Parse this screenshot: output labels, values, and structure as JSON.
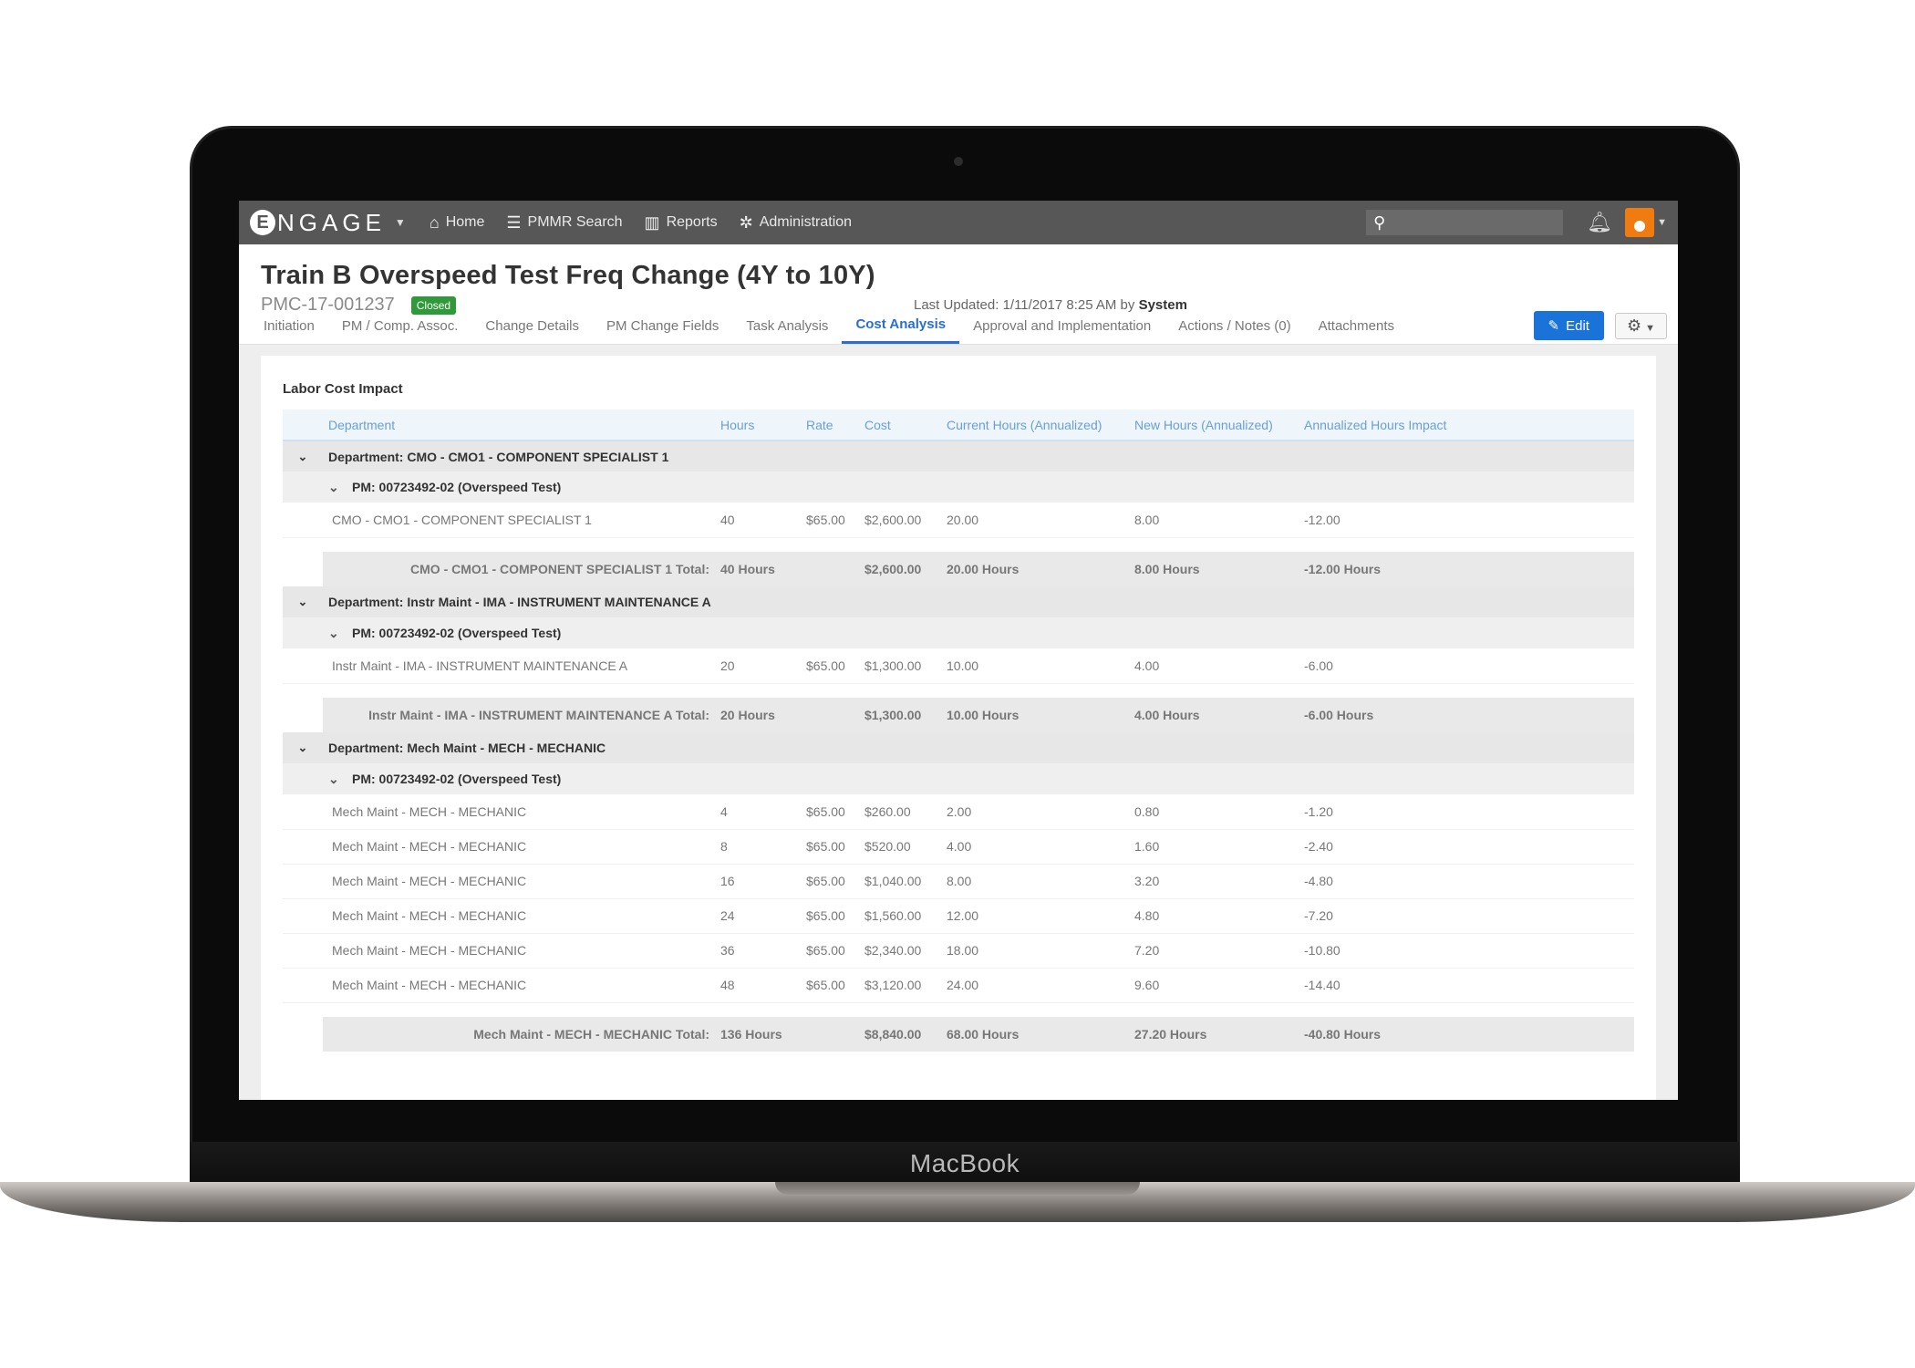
{
  "device": {
    "label": "MacBook"
  },
  "topbar": {
    "logo_letter": "E",
    "logo_text": "NGAGE",
    "nav": [
      {
        "label": "Home",
        "icon": "home-icon"
      },
      {
        "label": "PMMR Search",
        "icon": "list-icon"
      },
      {
        "label": "Reports",
        "icon": "chart-icon"
      },
      {
        "label": "Administration",
        "icon": "tools-icon"
      }
    ],
    "search_placeholder": ""
  },
  "header": {
    "title": "Train B Overspeed Test Freq Change (4Y to 10Y)",
    "record_id": "PMC-17-001237",
    "status": "Closed",
    "updated_prefix": "Last Updated: 1/11/2017 8:25 AM by",
    "updated_by": "System"
  },
  "tabs": [
    "Initiation",
    "PM / Comp. Assoc.",
    "Change Details",
    "PM Change Fields",
    "Task Analysis",
    "Cost Analysis",
    "Approval and Implementation",
    "Actions / Notes (0)",
    "Attachments"
  ],
  "active_tab": "Cost Analysis",
  "actions": {
    "edit_label": "Edit"
  },
  "colors": {
    "topbar": "#575757",
    "accent": "#1a73d9",
    "status": "#2f9a3a",
    "cost": "#2f9a3a"
  },
  "labor": {
    "title": "Labor Cost Impact",
    "columns": [
      "Department",
      "Hours",
      "Rate",
      "Cost",
      "Current Hours (Annualized)",
      "New Hours (Annualized)",
      "Annualized Hours Impact"
    ],
    "groups": [
      {
        "department": "Department: CMO - CMO1 - COMPONENT SPECIALIST 1",
        "pm": "PM: 00723492-02 (Overspeed Test)",
        "rows": [
          [
            "CMO - CMO1 - COMPONENT SPECIALIST 1",
            "40",
            "$65.00",
            "$2,600.00",
            "20.00",
            "8.00",
            "-12.00"
          ]
        ],
        "total": [
          "CMO - CMO1 - COMPONENT SPECIALIST 1 Total:",
          "40 Hours",
          "",
          "$2,600.00",
          "20.00 Hours",
          "8.00 Hours",
          "-12.00 Hours"
        ]
      },
      {
        "department": "Department: Instr Maint - IMA - INSTRUMENT MAINTENANCE A",
        "pm": "PM: 00723492-02 (Overspeed Test)",
        "rows": [
          [
            "Instr Maint - IMA - INSTRUMENT MAINTENANCE A",
            "20",
            "$65.00",
            "$1,300.00",
            "10.00",
            "4.00",
            "-6.00"
          ]
        ],
        "total": [
          "Instr Maint - IMA - INSTRUMENT MAINTENANCE A Total:",
          "20 Hours",
          "",
          "$1,300.00",
          "10.00 Hours",
          "4.00 Hours",
          "-6.00 Hours"
        ]
      },
      {
        "department": "Department: Mech Maint - MECH - MECHANIC",
        "pm": "PM: 00723492-02 (Overspeed Test)",
        "rows": [
          [
            "Mech Maint - MECH - MECHANIC",
            "4",
            "$65.00",
            "$260.00",
            "2.00",
            "0.80",
            "-1.20"
          ],
          [
            "Mech Maint - MECH - MECHANIC",
            "8",
            "$65.00",
            "$520.00",
            "4.00",
            "1.60",
            "-2.40"
          ],
          [
            "Mech Maint - MECH - MECHANIC",
            "16",
            "$65.00",
            "$1,040.00",
            "8.00",
            "3.20",
            "-4.80"
          ],
          [
            "Mech Maint - MECH - MECHANIC",
            "24",
            "$65.00",
            "$1,560.00",
            "12.00",
            "4.80",
            "-7.20"
          ],
          [
            "Mech Maint - MECH - MECHANIC",
            "36",
            "$65.00",
            "$2,340.00",
            "18.00",
            "7.20",
            "-10.80"
          ],
          [
            "Mech Maint - MECH - MECHANIC",
            "48",
            "$65.00",
            "$3,120.00",
            "24.00",
            "9.60",
            "-14.40"
          ]
        ],
        "total": [
          "Mech Maint - MECH - MECHANIC Total:",
          "136 Hours",
          "",
          "$8,840.00",
          "68.00 Hours",
          "27.20 Hours",
          "-40.80 Hours"
        ]
      }
    ]
  }
}
